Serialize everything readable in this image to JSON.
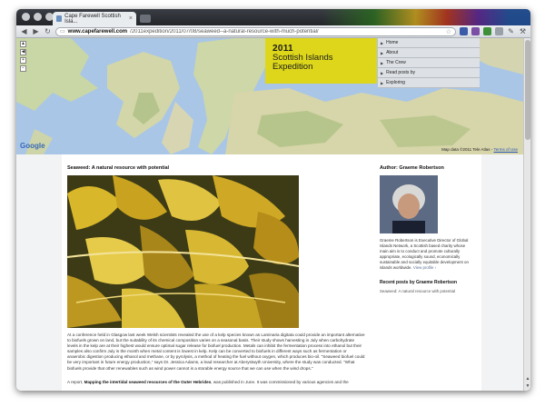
{
  "browser": {
    "tab_title": "Cape Farewell Scottish Isla...",
    "url_host": "www.capefarewell.com",
    "url_path": "/2011expedition/2011/07/08/seaweed--a-natural-resource-with-much-potential/"
  },
  "map": {
    "credit": "Map data ©2011 Tele Atlas -",
    "terms": "Terms of Use",
    "logo": "Google"
  },
  "logo": {
    "year": "2011",
    "line1": "Scottish Islands",
    "line2": "Expedition"
  },
  "menu": {
    "items": [
      {
        "label": "Home"
      },
      {
        "label": "About"
      },
      {
        "label": "The Crew"
      },
      {
        "label": "Read posts by"
      },
      {
        "label": "Exploring"
      }
    ]
  },
  "post": {
    "title": "Seaweed: A natural resource with potential",
    "paragraph1": "At a conference held in Glasgow last week Welsh scientists revealed the use of a kelp species known as Laminaria digitata could provide an important alternative to biofuels grown on land, but the suitability of its chemical composition varies on a seasonal basis. Their study shows harvesting in July when carbohydrate levels in the kelp are at their highest would ensure optimal sugar release for biofuel production. Metals can inhibit the fermentation process into ethanol but their samples also confirm July is the month when metal content is lowest in kelp. Kelp can be converted to biofuels in different ways such as fermentation or anaerobic digestion producing ethanol and methane, or by pyrolysis, a method of heating the fuel without oxygen, which produces bio-oil. \"Seaweed biofuel could be very important in future energy production,\" says Dr. Jessica Adams, a lead researcher at Aberystwyth University, where the study was conducted. \"What biofuels provide that other renewables such as wind power cannot is a storable energy source that we can use when the wind drops.\"",
    "p2_prefix": "A report, ",
    "p2_bold": "Mapping the intertidal seaweed resources of the Outer Hebrides",
    "p2_suffix": ", was published in June. It was commissioned by various agencies and the"
  },
  "sidebar": {
    "author_heading": "Author: Graeme Robertson",
    "bio": "Graeme Robertson is Executive Director of Global Islands Network, a Scottish based charity whose main aim is to conduct and promote culturally appropriate, ecologically sound, economically sustainable and socially equitable development on islands worldwide.",
    "view_profile": "View profile ›",
    "recent_heading": "Recent posts by Graeme Robertson",
    "recent_item": "Seaweed: A natural resource with potential"
  },
  "colors": {
    "accent_yellow": "#ddd61a",
    "sea": "#a9c6e7",
    "link": "#2a5ab8"
  }
}
